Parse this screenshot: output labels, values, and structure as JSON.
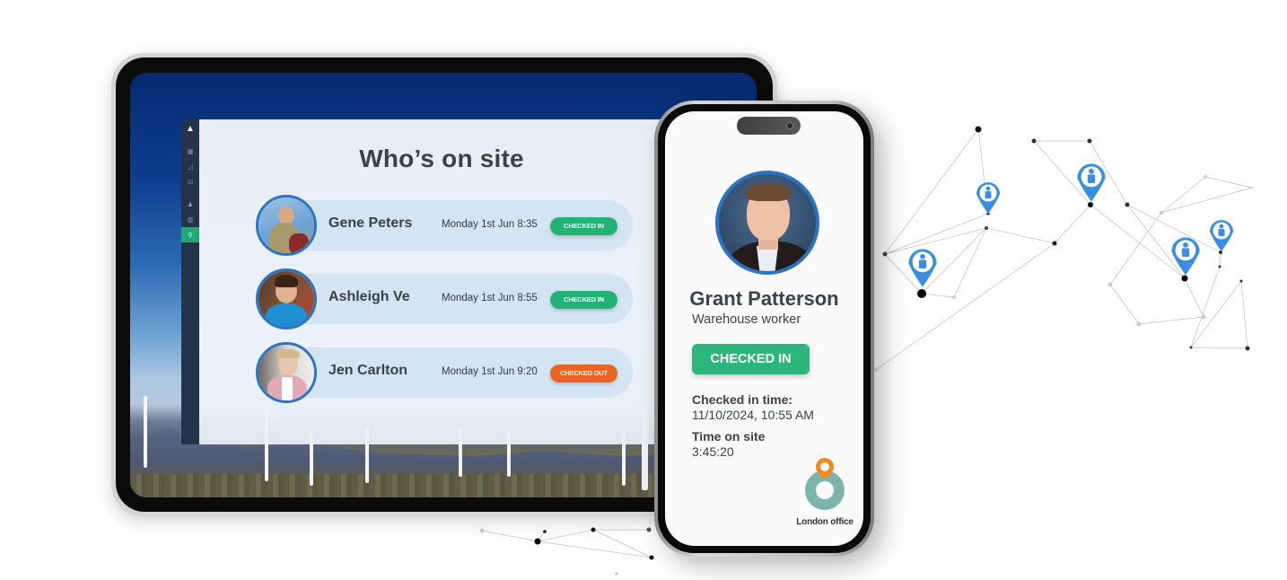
{
  "tablet_app": {
    "title": "Who’s on site",
    "sidebar": {
      "logo": "▲",
      "items": [
        {
          "icon": "dashboard-icon",
          "glyph": "▦",
          "active": false
        },
        {
          "icon": "chart-icon",
          "glyph": "◿",
          "active": false
        },
        {
          "icon": "checklist-icon",
          "glyph": "☑",
          "active": false
        },
        {
          "icon": "user-icon",
          "glyph": "♟",
          "active": false
        },
        {
          "icon": "building-icon",
          "glyph": "▥",
          "active": false
        },
        {
          "icon": "location-pin-icon",
          "glyph": "⚲",
          "active": true
        }
      ]
    },
    "rows": [
      {
        "name": "Gene Peters",
        "time": "Monday 1st Jun 8:35",
        "status": "CHECKED IN",
        "status_color": "#22b273"
      },
      {
        "name": "Ashleigh Ve",
        "time": "Monday 1st Jun 8:55",
        "status": "CHECKED IN",
        "status_color": "#22b273"
      },
      {
        "name": "Jen Carlton",
        "time": "Monday 1st Jun 9:20",
        "status": "CHECKED OUT",
        "status_color": "#ea6423"
      }
    ]
  },
  "phone_app": {
    "name": "Grant Patterson",
    "role": "Warehouse worker",
    "status": "CHECKED IN",
    "status_color": "#2cb67a",
    "checked_in_label": "Checked in time:",
    "checked_in_value": "11/10/2024,  10:55 AM",
    "time_on_site_label": "Time on site",
    "time_on_site_value": "3:45:20",
    "location": "London office"
  },
  "colors": {
    "accent_blue": "#2a74c0",
    "sidebar": "#22334a",
    "active_green": "#1fa97a",
    "pin_blue": "#3a8ee0",
    "pin_orange": "#f08a1c"
  }
}
